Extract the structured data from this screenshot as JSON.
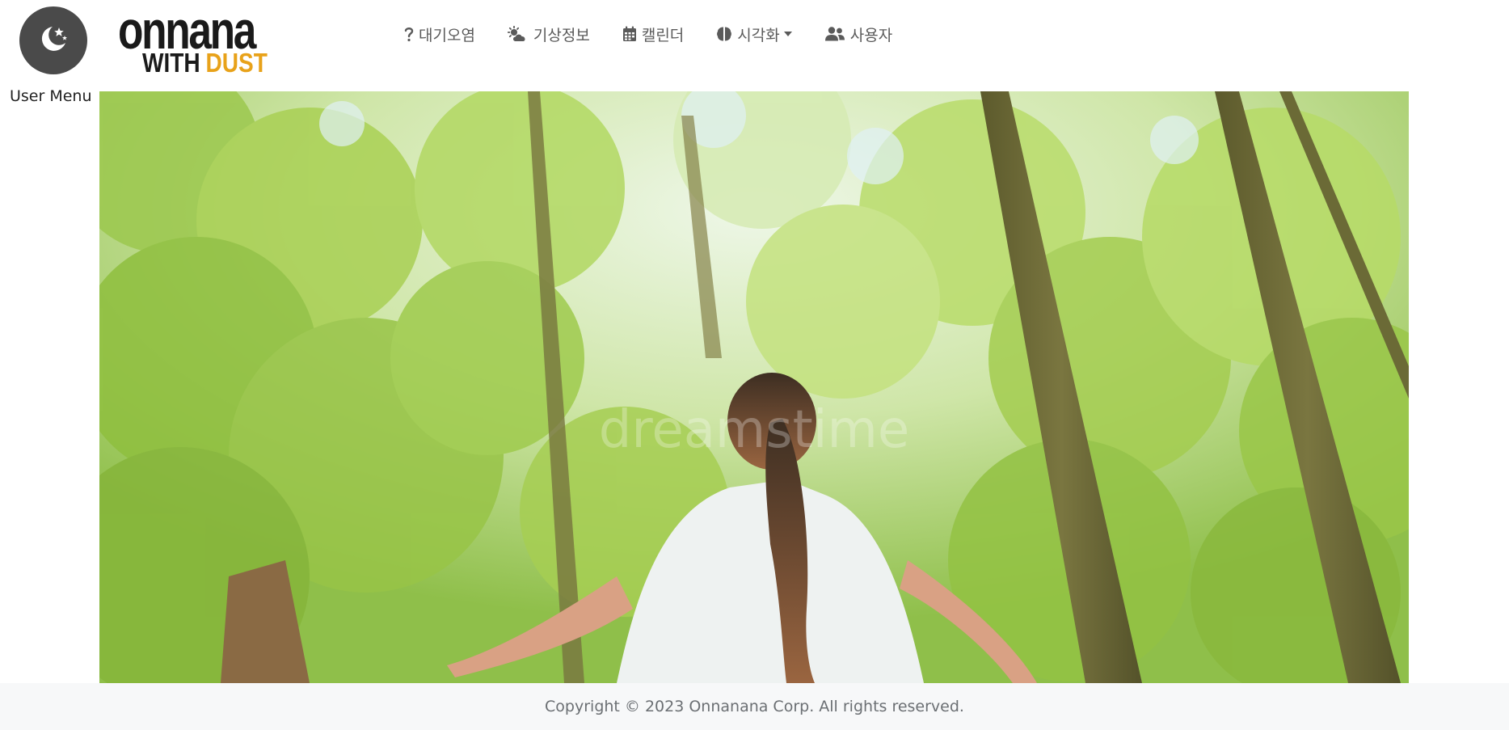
{
  "header": {
    "user_menu_label": "User Menu",
    "logo": {
      "top": "onnana",
      "bottom_left": "WITH",
      "bottom_right": "DUST"
    },
    "nav": [
      {
        "icon": "question-icon",
        "label": "대기오염",
        "has_dropdown": false
      },
      {
        "icon": "cloud-sun-icon",
        "label": "기상정보",
        "has_dropdown": false
      },
      {
        "icon": "calendar-icon",
        "label": "캘린더",
        "has_dropdown": false
      },
      {
        "icon": "brain-icon",
        "label": "시각화",
        "has_dropdown": true
      },
      {
        "icon": "users-icon",
        "label": "사용자",
        "has_dropdown": false
      }
    ]
  },
  "hero": {
    "image": "woman-in-forest-photo",
    "watermark": "dreamstime"
  },
  "footer": {
    "copyright": "Copyright © 2023 Onnanana Corp. All rights reserved."
  },
  "colors": {
    "accent": "#e8a21a",
    "user_button_bg": "#4a4a4a",
    "nav_text": "#5a5a5a",
    "footer_bg": "#f7f8f9"
  }
}
